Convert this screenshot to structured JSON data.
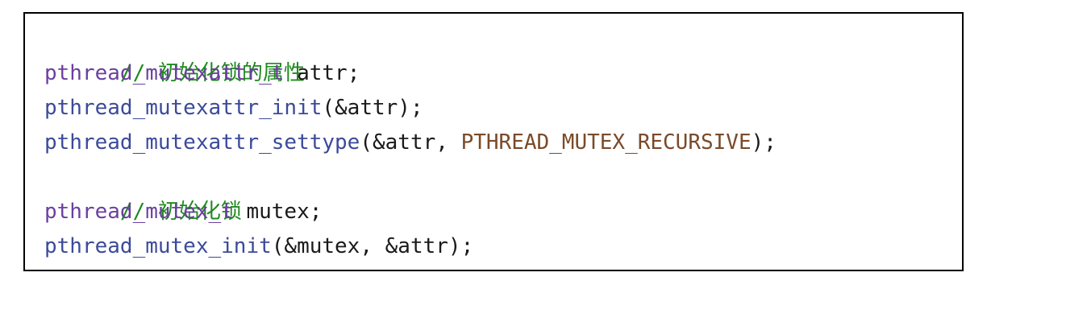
{
  "code_lines": [
    {
      "tokens": [
        {
          "kind": "comment",
          "text": "// 初始化锁的属性"
        }
      ]
    },
    {
      "tokens": [
        {
          "kind": "type",
          "text": "pthread_mutexattr_t"
        },
        {
          "kind": "plain",
          "text": " attr;"
        }
      ]
    },
    {
      "tokens": [
        {
          "kind": "func",
          "text": "pthread_mutexattr_init"
        },
        {
          "kind": "plain",
          "text": "(&attr);"
        }
      ]
    },
    {
      "tokens": [
        {
          "kind": "func",
          "text": "pthread_mutexattr_settype"
        },
        {
          "kind": "plain",
          "text": "(&attr, "
        },
        {
          "kind": "const",
          "text": "PTHREAD_MUTEX_RECURSIVE"
        },
        {
          "kind": "plain",
          "text": ");"
        }
      ]
    },
    {
      "tokens": [
        {
          "kind": "comment",
          "text": "// 初始化锁"
        }
      ]
    },
    {
      "tokens": [
        {
          "kind": "type",
          "text": "pthread_mutex_t"
        },
        {
          "kind": "plain",
          "text": " mutex;"
        }
      ]
    },
    {
      "tokens": [
        {
          "kind": "func",
          "text": "pthread_mutex_init"
        },
        {
          "kind": "plain",
          "text": "(&mutex, &attr);"
        }
      ]
    }
  ],
  "colors": {
    "comment": "#1f8a1f",
    "type": "#6b3fa0",
    "func": "#3b4a9a",
    "const": "#7a4a2a",
    "plain": "#1a1a1a"
  }
}
